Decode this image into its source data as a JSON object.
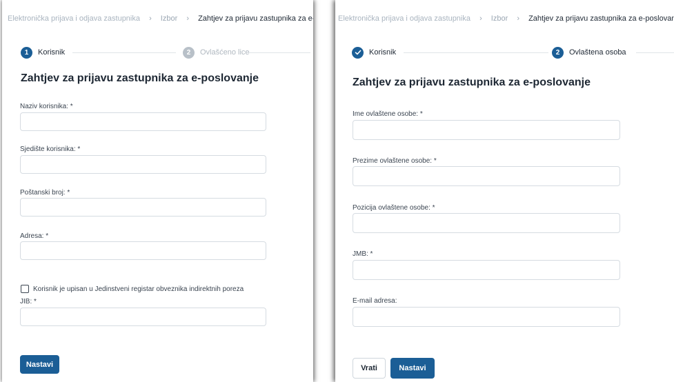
{
  "left": {
    "breadcrumb": [
      "Elektronička prijava i odjava zastupnika",
      "Izbor",
      "Zahtjev za prijavu zastupnika za e-poslovanje"
    ],
    "steps": [
      {
        "number": "1",
        "label": "Korisnik",
        "state": "active"
      },
      {
        "number": "2",
        "label": "Ovlašćeno lice",
        "state": "inactive"
      }
    ],
    "title": "Zahtjev za prijavu zastupnika za e-poslovanje",
    "fields": [
      {
        "label": "Naziv korisnika: *",
        "value": ""
      },
      {
        "label": "Sjedište korisnika: *",
        "value": ""
      },
      {
        "label": "Poštanski broj: *",
        "value": ""
      },
      {
        "label": "Adresa: *",
        "value": ""
      }
    ],
    "checkbox_label": "Korisnik je upisan u Jedinstveni registar obveznika indirektnih poreza",
    "checkbox_checked": false,
    "jib_label": "JIB: *",
    "next_button": "Nastavi"
  },
  "right": {
    "breadcrumb": [
      "Elektronička prijava i odjava zastupnika",
      "Izbor",
      "Zahtjev za prijavu zastupnika za e-poslovanje"
    ],
    "steps": [
      {
        "number": "1",
        "label": "Korisnik",
        "state": "completed"
      },
      {
        "number": "2",
        "label": "Ovlaštena osoba",
        "state": "active"
      }
    ],
    "title": "Zahtjev za prijavu zastupnika za e-poslovanje",
    "fields": [
      {
        "label": "Ime ovlaštene osobe: *",
        "value": ""
      },
      {
        "label": "Prezime ovlaštene osobe: *",
        "value": ""
      },
      {
        "label": "Pozicija ovlaštene osobe: *",
        "value": ""
      },
      {
        "label": "JMB: *",
        "value": ""
      },
      {
        "label": "E-mail adresa:",
        "value": ""
      }
    ],
    "back_button": "Vrati",
    "next_button": "Nastavi"
  },
  "colors": {
    "primary": "#1b5e96",
    "inactive_step": "#b8c0c8",
    "text": "#1d2733",
    "border": "#d5dbe1"
  }
}
